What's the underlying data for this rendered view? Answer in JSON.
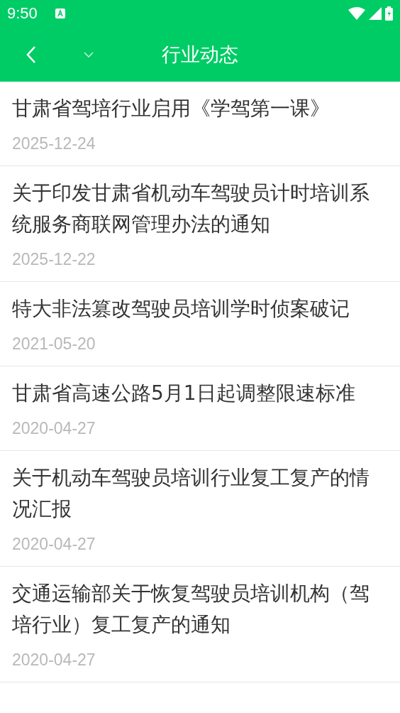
{
  "status_bar": {
    "time": "9:50"
  },
  "app_bar": {
    "title": "行业动态"
  },
  "articles": [
    {
      "title": "甘肃省驾培行业启用《学驾第一课》",
      "date": "2025-12-24"
    },
    {
      "title": "关于印发甘肃省机动车驾驶员计时培训系统服务商联网管理办法的通知",
      "date": "2025-12-22"
    },
    {
      "title": "特大非法篡改驾驶员培训学时侦案破记",
      "date": "2021-05-20"
    },
    {
      "title": "甘肃省高速公路5月1日起调整限速标准",
      "date": "2020-04-27"
    },
    {
      "title": "关于机动车驾驶员培训行业复工复产的情况汇报",
      "date": "2020-04-27"
    },
    {
      "title": "交通运输部关于恢复驾驶员培训机构（驾培行业）复工复产的通知",
      "date": "2020-04-27"
    }
  ]
}
